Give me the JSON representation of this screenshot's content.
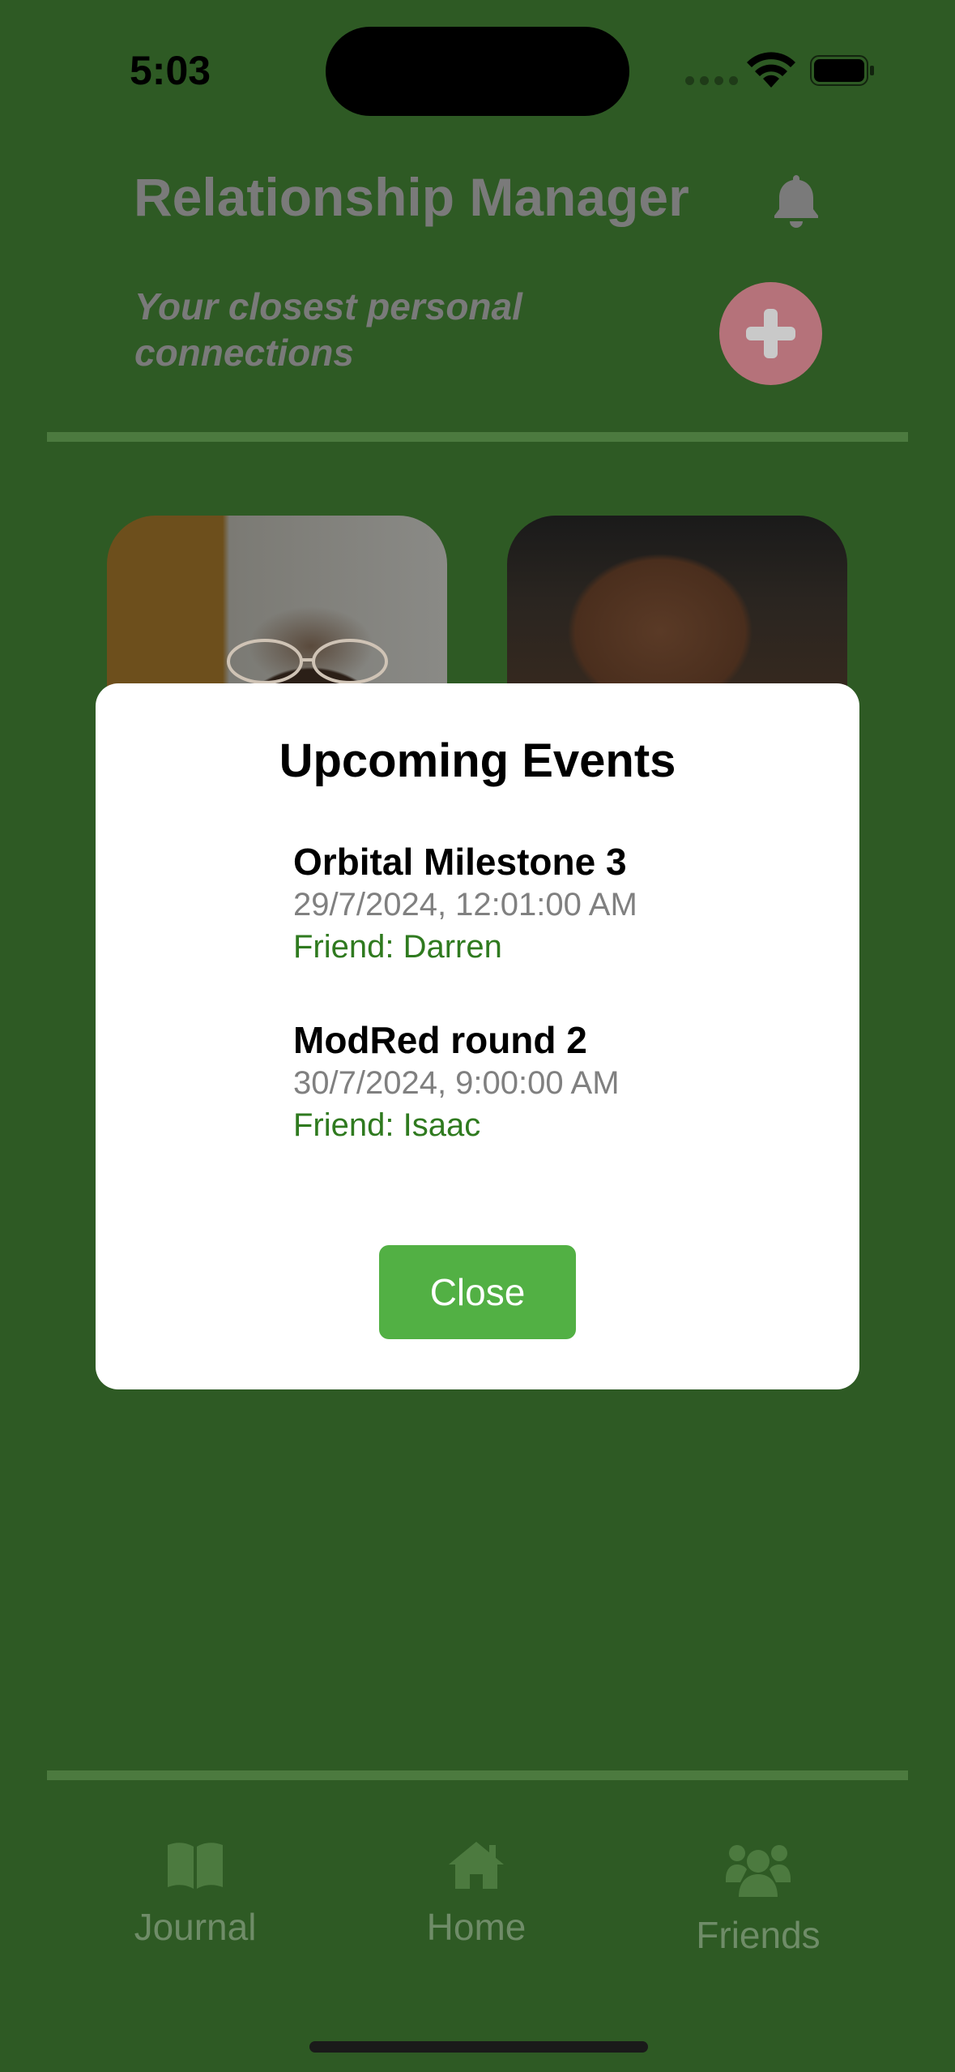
{
  "status_bar": {
    "time": "5:03"
  },
  "header": {
    "title": "Relationship Manager",
    "subtitle": "Your closest personal connections",
    "bell_icon": "bell-icon",
    "add_icon": "plus-icon"
  },
  "dialog": {
    "title": "Upcoming Events",
    "events": [
      {
        "name": "Orbital Milestone 3",
        "datetime": "29/7/2024, 12:01:00 AM",
        "friend": "Friend: Darren"
      },
      {
        "name": "ModRed round 2",
        "datetime": "30/7/2024, 9:00:00 AM",
        "friend": "Friend: Isaac"
      }
    ],
    "close_label": "Close"
  },
  "tab_bar": {
    "items": [
      {
        "label": "Journal",
        "icon": "book-icon"
      },
      {
        "label": "Home",
        "icon": "home-icon"
      },
      {
        "label": "Friends",
        "icon": "users-icon"
      }
    ]
  },
  "colors": {
    "background": "#2e5a24",
    "accent_green": "#52b044",
    "friend_text": "#2f7a1f",
    "add_button": "#b5727a"
  }
}
